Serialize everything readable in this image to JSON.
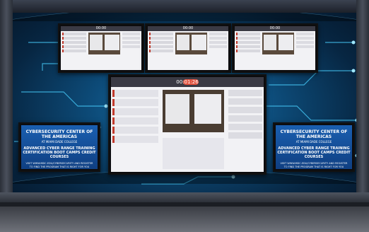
{
  "top_screens": [
    {
      "timer": "00:00"
    },
    {
      "timer": "00:00"
    },
    {
      "timer": "00:00"
    }
  ],
  "main_screen": {
    "timer": "00:01:26"
  },
  "promo_screens": [
    {
      "headline": "CYBERSECURITY CENTER OF THE AMERICAS",
      "subline": "AT MIAMI DADE COLLEGE",
      "offer": "ADVANCED CYBER RANGE TRAINING CERTIFICATION BOOT CAMPS CREDIT COURSES",
      "cta": "VISIT WWW.MDC.EDU/CYBERSECURITY AND REGISTER TO FIND THE PROGRAM THAT IS RIGHT FOR YOU"
    },
    {
      "headline": "CYBERSECURITY CENTER OF THE AMERICAS",
      "subline": "AT MIAMI DADE COLLEGE",
      "offer": "ADVANCED CYBER RANGE TRAINING CERTIFICATION BOOT CAMPS CREDIT COURSES",
      "cta": "VISIT WWW.MDC.EDU/CYBERSECURITY AND REGISTER TO FIND THE PROGRAM THAT IS RIGHT FOR YOU"
    }
  ],
  "colors": {
    "wall_glow": "#1f7fb8",
    "circuit": "#49d0ff",
    "alert": "#c0392b",
    "promo": "#1a5fb0"
  }
}
